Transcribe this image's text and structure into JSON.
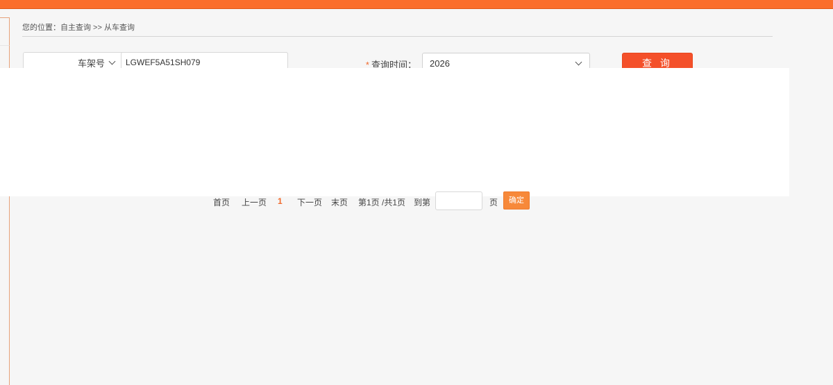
{
  "breadcrumb": {
    "text": "您的位置：自主查询 >> 从车查询"
  },
  "search": {
    "type_selected": "车架号",
    "vin_value": "LGWEF5A51SH079",
    "time_required_mark": "*",
    "time_label": "查询时间：",
    "year_selected": "2026",
    "query_label": "查 询"
  },
  "pagination": {
    "first": "首页",
    "prev": "上一页",
    "current": "1",
    "next": "下一页",
    "last": "末页",
    "page_info": "第1页 /共1页",
    "goto_label": "到第",
    "page_suffix": "页",
    "page_input_value": "",
    "confirm_label": "确定"
  },
  "colors": {
    "top_bar": "#fb6e2b",
    "query_button": "#f4502a",
    "confirm_button": "#f7893a",
    "current_page": "#f06a2c"
  }
}
